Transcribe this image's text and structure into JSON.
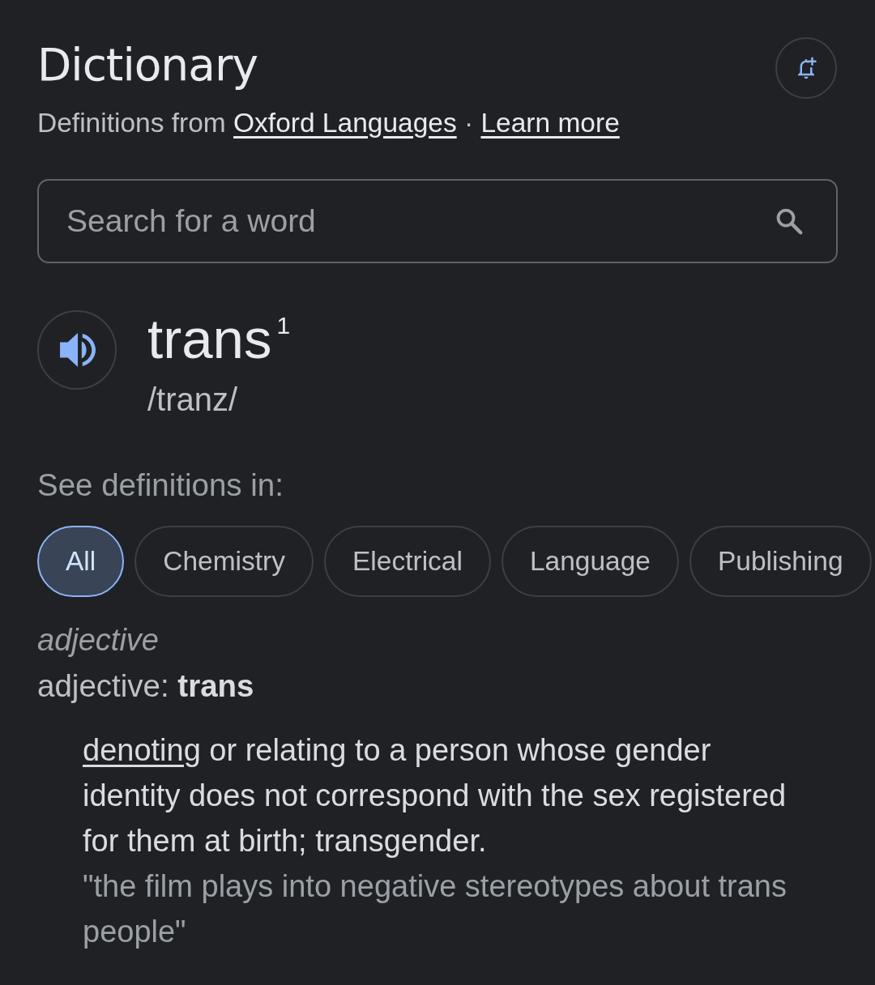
{
  "header": {
    "title": "Dictionary",
    "attribution": {
      "text": "Definitions from",
      "source_link": "Oxford Languages",
      "separator": "·",
      "more_link": "Learn more"
    }
  },
  "search": {
    "placeholder": "Search for a word"
  },
  "entry": {
    "headword": "trans$^{1}$",
    "phonetic": "/tranz/"
  },
  "filter": {
    "label": "See definitions in:",
    "chips": [
      {
        "label": "All",
        "selected": true
      },
      {
        "label": "Chemistry",
        "selected": false
      },
      {
        "label": "Electrical",
        "selected": false
      },
      {
        "label": "Language",
        "selected": false
      },
      {
        "label": "Publishing",
        "selected": false
      }
    ]
  },
  "sense": {
    "part_of_speech": "adjective",
    "inflection": "adjective: **trans**",
    "definition": {
      "link_word": "denoting",
      "text": "or relating to a person whose gender identity does not correspond with the sex registered for them at birth; transgender."
    },
    "example": "\"the film plays into negative stereotypes about trans people\""
  }
}
